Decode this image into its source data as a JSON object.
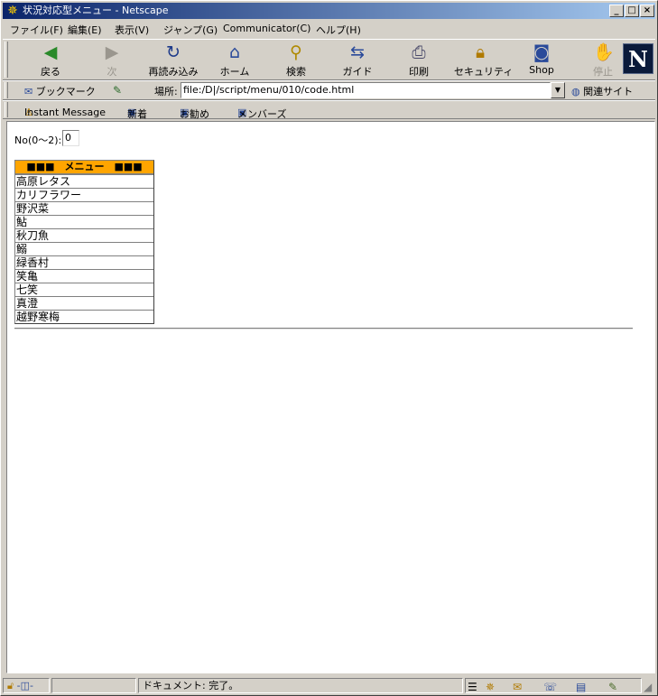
{
  "window": {
    "title": "状況対応型メニュー - Netscape"
  },
  "menubar": [
    "ファイル(F)",
    "編集(E)",
    "表示(V)",
    "ジャンプ(G)",
    "Communicator(C)",
    "ヘルプ(H)"
  ],
  "toolbar": {
    "back": "戻る",
    "forward": "次",
    "reload": "再読み込み",
    "home": "ホーム",
    "search": "検索",
    "guide": "ガイド",
    "print": "印刷",
    "security": "セキュリティ",
    "shop": "Shop",
    "stop": "停止"
  },
  "location": {
    "bookmarks_label": "ブックマーク",
    "label": "場所:",
    "url": "file:/D|/script/menu/010/code.html",
    "related": "関連サイト"
  },
  "personal": [
    "Instant Message",
    "新着",
    "お勧め",
    "メンバーズ"
  ],
  "page": {
    "no_label": "No(0〜2):",
    "no_value": "0",
    "menu_header": "■■■　メニュー　■■■",
    "menu_items": [
      "高原レタス",
      "カリフラワー",
      "野沢菜",
      "鮎",
      "秋刀魚",
      "鰯",
      "緑香村",
      "笑亀",
      "七笑",
      "真澄",
      "越野寒梅"
    ]
  },
  "status": {
    "text": "ドキュメント: 完了。"
  }
}
